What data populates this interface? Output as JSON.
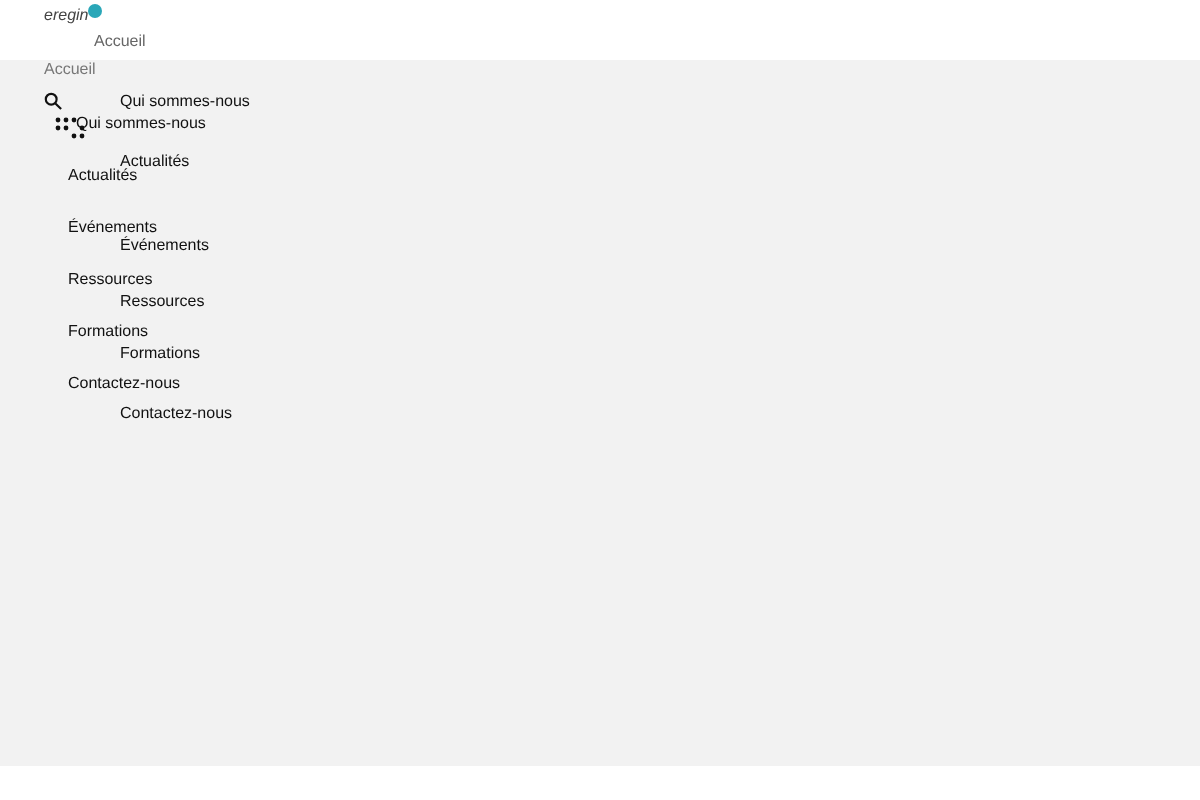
{
  "logo": {
    "text": "eregin"
  },
  "menu_primary": [
    {
      "label": "Accueil",
      "selected": false
    },
    {
      "label": "Qui sommes-nous",
      "selected": false
    },
    {
      "label": "Actualités",
      "selected": false
    },
    {
      "label": "Événements",
      "selected": false
    },
    {
      "label": "Ressources",
      "selected": false
    },
    {
      "label": "Formations",
      "selected": false
    },
    {
      "label": "Contactez-nous",
      "selected": false
    }
  ],
  "menu_secondary": [
    {
      "label": "Accueil",
      "selected": false
    },
    {
      "label": "Qui sommes-nous",
      "selected": false
    },
    {
      "label": "Actualités",
      "selected": false
    },
    {
      "label": "Événements",
      "selected": false
    },
    {
      "label": "Ressources",
      "selected": false
    },
    {
      "label": "Formations",
      "selected": false
    },
    {
      "label": "Contactez-nous",
      "selected": false
    }
  ]
}
